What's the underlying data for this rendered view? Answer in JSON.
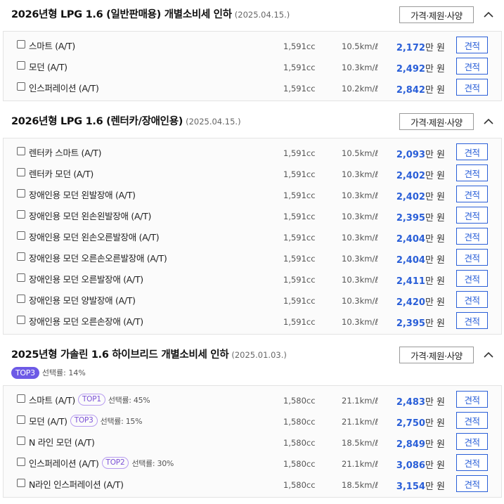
{
  "controls": {
    "spec_label": "가격·제원·사양",
    "quote_label": "견적",
    "price_unit": "만 원"
  },
  "colors": {
    "accent_blue": "#2a5fd8",
    "badge_purple": "#6d5ae6"
  },
  "sections": [
    {
      "title": "2026년형 LPG 1.6 (일반판매용) 개별소비세 인하",
      "date": "(2025.04.15.)",
      "rows": [
        {
          "name": "스마트 (A/T)",
          "cc": "1,591cc",
          "eff": "10.5km/ℓ",
          "price": "2,172"
        },
        {
          "name": "모던 (A/T)",
          "cc": "1,591cc",
          "eff": "10.3km/ℓ",
          "price": "2,492"
        },
        {
          "name": "인스퍼레이션 (A/T)",
          "cc": "1,591cc",
          "eff": "10.2km/ℓ",
          "price": "2,842"
        }
      ]
    },
    {
      "title": "2026년형 LPG 1.6 (렌터카/장애인용)",
      "date": "(2025.04.15.)",
      "rows": [
        {
          "name": "렌터카 스마트 (A/T)",
          "cc": "1,591cc",
          "eff": "10.5km/ℓ",
          "price": "2,093"
        },
        {
          "name": "렌터카 모던 (A/T)",
          "cc": "1,591cc",
          "eff": "10.3km/ℓ",
          "price": "2,402"
        },
        {
          "name": "장애인용 모던 왼발장애 (A/T)",
          "cc": "1,591cc",
          "eff": "10.3km/ℓ",
          "price": "2,402"
        },
        {
          "name": "장애인용 모던 왼손왼발장애 (A/T)",
          "cc": "1,591cc",
          "eff": "10.3km/ℓ",
          "price": "2,395"
        },
        {
          "name": "장애인용 모던 왼손오른발장애 (A/T)",
          "cc": "1,591cc",
          "eff": "10.3km/ℓ",
          "price": "2,404"
        },
        {
          "name": "장애인용 모던 오른손오른발장애 (A/T)",
          "cc": "1,591cc",
          "eff": "10.3km/ℓ",
          "price": "2,404"
        },
        {
          "name": "장애인용 모던 오른발장애 (A/T)",
          "cc": "1,591cc",
          "eff": "10.3km/ℓ",
          "price": "2,411"
        },
        {
          "name": "장애인용 모던 양발장애 (A/T)",
          "cc": "1,591cc",
          "eff": "10.3km/ℓ",
          "price": "2,420"
        },
        {
          "name": "장애인용 모던 오른손장애 (A/T)",
          "cc": "1,591cc",
          "eff": "10.3km/ℓ",
          "price": "2,395"
        }
      ]
    },
    {
      "title": "2025년형 가솔린 1.6 하이브리드 개별소비세 인하",
      "date": "(2025.01.03.)",
      "badge": "TOP3",
      "badge_rate": "선택률: 14%",
      "rows": [
        {
          "name": "스마트 (A/T)",
          "badge": "TOP1",
          "rate": "선택률: 45%",
          "cc": "1,580cc",
          "eff": "21.1km/ℓ",
          "price": "2,483"
        },
        {
          "name": "모던 (A/T)",
          "badge": "TOP3",
          "rate": "선택률: 15%",
          "cc": "1,580cc",
          "eff": "21.1km/ℓ",
          "price": "2,750"
        },
        {
          "name": "N 라인 모던 (A/T)",
          "cc": "1,580cc",
          "eff": "18.5km/ℓ",
          "price": "2,849"
        },
        {
          "name": "인스퍼레이션 (A/T)",
          "badge": "TOP2",
          "rate": "선택률: 30%",
          "cc": "1,580cc",
          "eff": "21.1km/ℓ",
          "price": "3,086"
        },
        {
          "name": "N라인 인스퍼레이션 (A/T)",
          "cc": "1,580cc",
          "eff": "18.5km/ℓ",
          "price": "3,154"
        }
      ]
    }
  ]
}
